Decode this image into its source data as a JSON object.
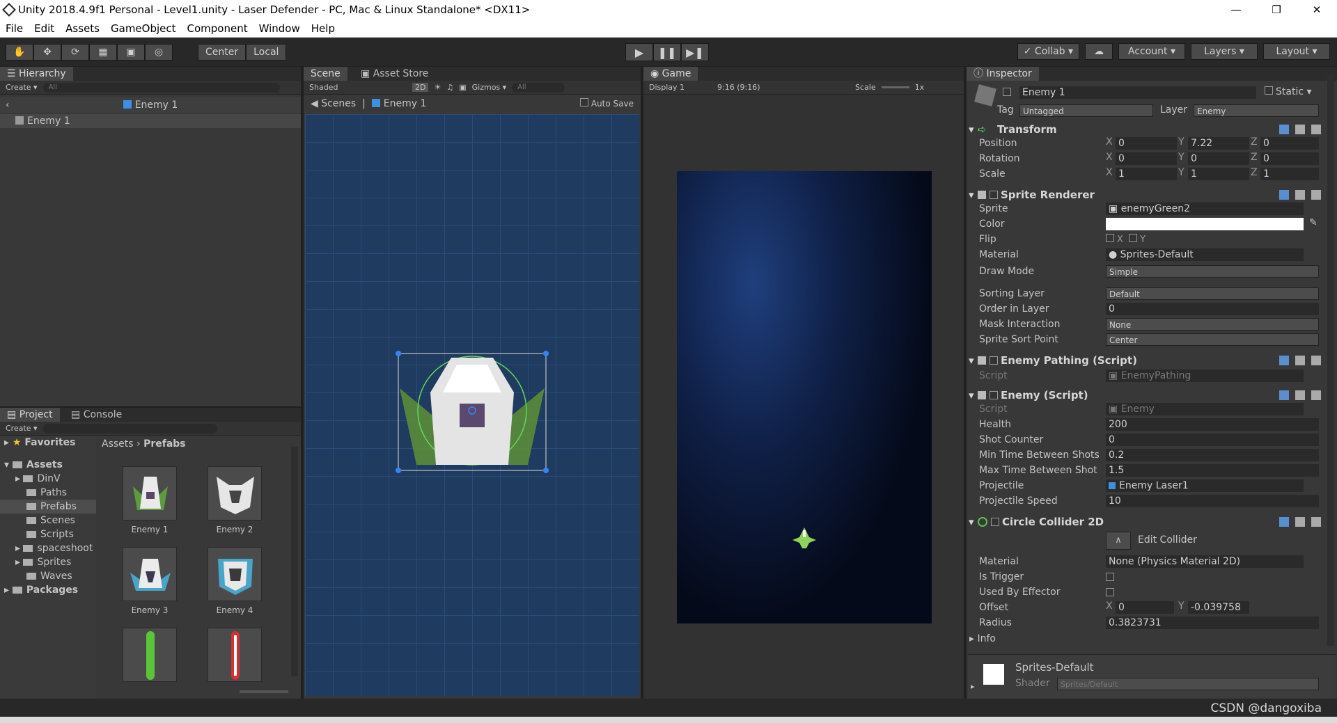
{
  "window": {
    "title": "Unity 2018.4.9f1 Personal - Level1.unity - Laser Defender - PC, Mac & Linux Standalone* <DX11>"
  },
  "menu": [
    "File",
    "Edit",
    "Assets",
    "GameObject",
    "Component",
    "Window",
    "Help"
  ],
  "toolbar": {
    "center": "Center",
    "local": "Local",
    "collab": "Collab",
    "account": "Account",
    "layers": "Layers",
    "layout": "Layout"
  },
  "hierarchy": {
    "tab": "Hierarchy",
    "create": "Create",
    "search_placeholder": "All",
    "crumb": "Enemy 1",
    "items": [
      "Enemy 1"
    ]
  },
  "project": {
    "tab": "Project",
    "console_tab": "Console",
    "create": "Create",
    "tree": [
      "Favorites",
      "Assets",
      "DinV",
      "Paths",
      "Prefabs",
      "Scenes",
      "Scripts",
      "spaceshoot",
      "Sprites",
      "Waves",
      "Packages"
    ],
    "breadcrumb": [
      "Assets",
      "Prefabs"
    ],
    "assets": [
      "Enemy 1",
      "Enemy 2",
      "Enemy 3",
      "Enemy 4"
    ]
  },
  "scene": {
    "tab": "Scene",
    "asset_store_tab": "Asset Store",
    "shaded": "Shaded",
    "mode2d": "2D",
    "gizmos": "Gizmos",
    "search_placeholder": "All",
    "crumb_scenes": "Scenes",
    "crumb_obj": "Enemy 1",
    "autosave": "Auto Save"
  },
  "game": {
    "tab": "Game",
    "display": "Display 1",
    "aspect": "9:16 (9:16)",
    "scale_label": "Scale",
    "scale_value": "1x"
  },
  "inspector": {
    "tab": "Inspector",
    "name": "Enemy 1",
    "static": "Static",
    "tag_label": "Tag",
    "tag": "Untagged",
    "layer_label": "Layer",
    "layer": "Enemy",
    "transform": {
      "title": "Transform",
      "position": {
        "label": "Position",
        "x": "0",
        "y": "7.22",
        "z": "0"
      },
      "rotation": {
        "label": "Rotation",
        "x": "0",
        "y": "0",
        "z": "0"
      },
      "scale": {
        "label": "Scale",
        "x": "1",
        "y": "1",
        "z": "1"
      }
    },
    "sprite_renderer": {
      "title": "Sprite Renderer",
      "sprite_label": "Sprite",
      "sprite": "enemyGreen2",
      "color_label": "Color",
      "flip_label": "Flip",
      "flip_x": "X",
      "flip_y": "Y",
      "material_label": "Material",
      "material": "Sprites-Default",
      "draw_mode_label": "Draw Mode",
      "draw_mode": "Simple",
      "sorting_layer_label": "Sorting Layer",
      "sorting_layer": "Default",
      "order_label": "Order in Layer",
      "order": "0",
      "mask_label": "Mask Interaction",
      "mask": "None",
      "sort_point_label": "Sprite Sort Point",
      "sort_point": "Center"
    },
    "enemy_pathing": {
      "title": "Enemy Pathing (Script)",
      "script_label": "Script",
      "script": "EnemyPathing"
    },
    "enemy": {
      "title": "Enemy (Script)",
      "script_label": "Script",
      "script": "Enemy",
      "health_label": "Health",
      "health": "200",
      "shot_label": "Shot Counter",
      "shot": "0",
      "min_label": "Min Time Between Shots",
      "min": "0.2",
      "max_label": "Max Time Between Shot",
      "max": "1.5",
      "proj_label": "Projectile",
      "proj": "Enemy Laser1",
      "speed_label": "Projectile Speed",
      "speed": "10"
    },
    "collider": {
      "title": "Circle Collider 2D",
      "edit": "Edit Collider",
      "material_label": "Material",
      "material": "None (Physics Material 2D)",
      "trigger_label": "Is Trigger",
      "effector_label": "Used By Effector",
      "offset_label": "Offset",
      "offset_x": "0",
      "offset_y": "-0.039758",
      "radius_label": "Radius",
      "radius": "0.3823731",
      "info_label": "Info"
    },
    "material_footer": {
      "name": "Sprites-Default",
      "shader_label": "Shader",
      "shader": "Sprites/Default"
    }
  },
  "watermark": "CSDN @dangoxiba"
}
